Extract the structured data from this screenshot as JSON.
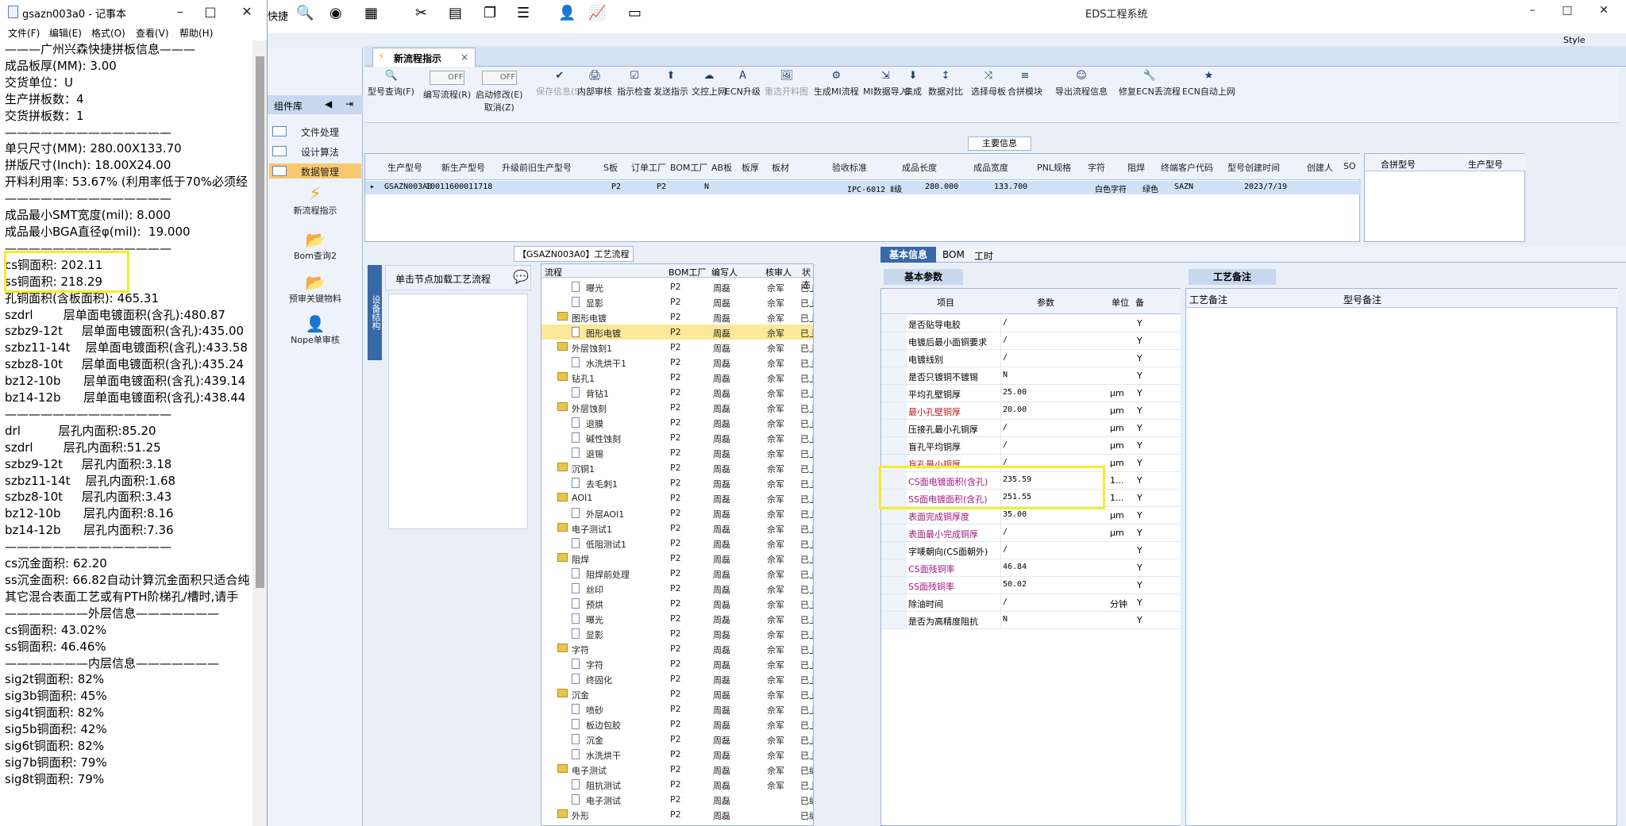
{
  "notepad": {
    "title": "gsazn003a0 - 记事本",
    "menu": [
      "文件(F)",
      "编辑(E)",
      "格式(O)",
      "查看(V)",
      "帮助(H)"
    ],
    "lines": [
      "———广州兴森快捷拼板信息———",
      "成品板厚(MM): 3.00",
      "交货单位：U",
      "生产拼板数：4",
      "交货拼板数：1",
      "——————————————",
      "单只尺寸(MM): 280.00X133.70",
      "拼版尺寸(Inch): 18.00X24.00",
      "开料利用率: 53.67% (利用率低于70%必须经",
      "——————————————",
      "成品最小SMT宽度(mil): 8.000",
      "成品最小BGA直径φ(mil):  19.000",
      "——————————————",
      "cs铜面积: 202.11",
      "ss铜面积: 218.29",
      "孔铜面积(含板面积): 465.31",
      "szdrl        层单面电镀面积(含孔):480.87",
      "szbz9-12t     层单面电镀面积(含孔):435.00",
      "szbz11-14t    层单面电镀面积(含孔):433.58",
      "szbz8-10t     层单面电镀面积(含孔):435.24",
      "bz12-10b      层单面电镀面积(含孔):439.14",
      "bz14-12b      层单面电镀面积(含孔):438.44",
      "",
      "——————————————",
      "drl          层孔内面积:85.20",
      "szdrl        层孔内面积:51.25",
      "szbz9-12t     层孔内面积:3.18",
      "szbz11-14t    层孔内面积:1.68",
      "szbz8-10t     层孔内面积:3.43",
      "bz12-10b      层孔内面积:8.16",
      "bz14-12b      层孔内面积:7.36",
      "",
      "——————————————",
      "cs沉金面积: 62.20",
      "ss沉金面积: 66.82自动计算沉金面积只适合纯",
      "其它混合表面工艺或有PTH阶梯孔/槽时,请手",
      "———————外层信息———————",
      "cs铜面积: 43.02%",
      "ss铜面积: 46.46%",
      "———————内层信息———————",
      "sig2t铜面积: 82%",
      "sig3b铜面积: 45%",
      "sig4t铜面积: 82%",
      "sig5b铜面积: 42%",
      "sig6t铜面积: 82%",
      "sig7b铜面积: 79%",
      "sig8t铜面积: 79%"
    ]
  },
  "eds": {
    "title": "EDS工程系统",
    "quick": "快捷",
    "style": "Style",
    "panel_title": "组件库",
    "nav": [
      "文件处理",
      "设计算法",
      "数据管理"
    ],
    "tools": [
      "新流程指示",
      "Bom查询2",
      "预审关键物料",
      "Nope单审核"
    ],
    "tab": "新流程指示",
    "toolbar": [
      "型号查询(F)",
      "编写流程(R)",
      "启动修改(E)",
      "保存信息(S)",
      "内部审核",
      "指示检查",
      "发送指示",
      "文控上网",
      "ECN升级",
      "重选开料图",
      "生成MI流程",
      "MI数据导入",
      "集成",
      "数据对比",
      "选择母板",
      "合拼模块",
      "导出流程信息",
      "修复ECN丢流程",
      "ECN自动上网"
    ],
    "toolbar_sub": "取消(Z)",
    "off": "OFF",
    "main_info": "主要信息",
    "main_cols": [
      "生产型号",
      "新生产型号",
      "升级前旧生产型号",
      "S板",
      "订单工厂",
      "BOM工厂",
      "AB板",
      "板厚",
      "板材",
      "验收标准",
      "成品长度",
      "成品宽度",
      "PNL规格",
      "字符",
      "阻焊",
      "终端客户代码",
      "型号创建时间",
      "创建人",
      "SO"
    ],
    "main_row": {
      "model": "GSAZN003A0",
      "new_model": "10011600011718",
      "order_factory": "P2",
      "bom_factory": "P2",
      "ab": "N",
      "standard": "IPC-6012 Ⅱ级",
      "length": "280.000",
      "width": "133.700",
      "char": "白色字符",
      "solder": "绿色",
      "customer": "SAZN",
      "created": "2023/7/19"
    },
    "right_cols": [
      "合拼型号",
      "生产型号"
    ],
    "process_title": "【GSAZN003A0】工艺流程",
    "side_tab": "设备结构",
    "click_tip": "单击节点加载工艺流程",
    "tree_cols": [
      "流程",
      "BOM工厂",
      "编写人",
      "核审人",
      "状态"
    ],
    "tree": [
      {
        "l": 2,
        "n": "曝光",
        "f": 0,
        "s": "已上R"
      },
      {
        "l": 2,
        "n": "显影",
        "f": 0,
        "s": "已上R"
      },
      {
        "l": 1,
        "n": "图形电镀",
        "f": 1,
        "s": "已上R"
      },
      {
        "l": 2,
        "n": "图形电镀",
        "f": 0,
        "s": "已上R",
        "sel": true
      },
      {
        "l": 1,
        "n": "外层蚀刻1",
        "f": 1,
        "s": "已上R"
      },
      {
        "l": 2,
        "n": "水洗烘干1",
        "f": 0,
        "s": "已上R"
      },
      {
        "l": 1,
        "n": "钻孔1",
        "f": 1,
        "s": "已上R"
      },
      {
        "l": 2,
        "n": "背钻1",
        "f": 0,
        "s": "已上R"
      },
      {
        "l": 1,
        "n": "外层蚀刻",
        "f": 1,
        "s": "已上R"
      },
      {
        "l": 2,
        "n": "退膜",
        "f": 0,
        "s": "已上R"
      },
      {
        "l": 2,
        "n": "碱性蚀刻",
        "f": 0,
        "s": "已上R"
      },
      {
        "l": 2,
        "n": "退锡",
        "f": 0,
        "s": "已上R"
      },
      {
        "l": 1,
        "n": "沉铜1",
        "f": 1,
        "s": "已上R"
      },
      {
        "l": 2,
        "n": "去毛刺1",
        "f": 0,
        "s": "已上R"
      },
      {
        "l": 1,
        "n": "AOI1",
        "f": 1,
        "s": "已上R"
      },
      {
        "l": 2,
        "n": "外层AOI1",
        "f": 0,
        "s": "已上R"
      },
      {
        "l": 1,
        "n": "电子测试1",
        "f": 1,
        "s": "已上R"
      },
      {
        "l": 2,
        "n": "低阻测试1",
        "f": 0,
        "s": "已上R"
      },
      {
        "l": 1,
        "n": "阻焊",
        "f": 1,
        "s": "已上R"
      },
      {
        "l": 2,
        "n": "阻焊前处理",
        "f": 0,
        "s": "已上R"
      },
      {
        "l": 2,
        "n": "丝印",
        "f": 0,
        "s": "已上R"
      },
      {
        "l": 2,
        "n": "预烘",
        "f": 0,
        "s": "已上R"
      },
      {
        "l": 2,
        "n": "曝光",
        "f": 0,
        "s": "已上R"
      },
      {
        "l": 2,
        "n": "显影",
        "f": 0,
        "s": "已上R"
      },
      {
        "l": 1,
        "n": "字符",
        "f": 1,
        "s": "已上R"
      },
      {
        "l": 2,
        "n": "字符",
        "f": 0,
        "s": "已上R"
      },
      {
        "l": 2,
        "n": "终固化",
        "f": 0,
        "s": "已上R"
      },
      {
        "l": 1,
        "n": "沉金",
        "f": 1,
        "s": "已上R"
      },
      {
        "l": 2,
        "n": "喷砂",
        "f": 0,
        "s": "已上R"
      },
      {
        "l": 2,
        "n": "板边包胶",
        "f": 0,
        "s": "已上R"
      },
      {
        "l": 2,
        "n": "沉金",
        "f": 0,
        "s": "已上R"
      },
      {
        "l": 2,
        "n": "水洗烘干",
        "f": 0,
        "s": "已上R"
      },
      {
        "l": 1,
        "n": "电子测试",
        "f": 1,
        "s": "已编S"
      },
      {
        "l": 2,
        "n": "阻抗测试",
        "f": 0,
        "s": "已上R"
      },
      {
        "l": 2,
        "n": "电子测试",
        "f": 0,
        "s": "已编S",
        "noaudit": true
      },
      {
        "l": 1,
        "n": "外形",
        "f": 1,
        "s": "已编S",
        "noaudit": true
      }
    ],
    "tree_factory": "P2",
    "tree_writer": "周磊",
    "tree_auditor": "佘军",
    "bi_tabs": [
      "基本信息",
      "BOM",
      "工时"
    ],
    "bp_title": "基本参数",
    "bp_cols": [
      "项目",
      "参数",
      "单位",
      "备"
    ],
    "bp_rows": [
      {
        "k": "是否贴导电胶",
        "v": "/",
        "u": "",
        "y": "Y",
        "c": ""
      },
      {
        "k": "电镀后最小面铜要求",
        "v": "/",
        "u": "",
        "y": "Y",
        "c": ""
      },
      {
        "k": "电镀线别",
        "v": "/",
        "u": "",
        "y": "Y",
        "c": ""
      },
      {
        "k": "是否只镀铜不镀锡",
        "v": "N",
        "u": "",
        "y": "Y",
        "c": ""
      },
      {
        "k": "平均孔壁铜厚",
        "v": "25.00",
        "u": "μm",
        "y": "Y",
        "c": ""
      },
      {
        "k": "最小孔壁铜厚",
        "v": "20.00",
        "u": "μm",
        "y": "Y",
        "c": "red"
      },
      {
        "k": "压接孔最小孔铜厚",
        "v": "/",
        "u": "μm",
        "y": "Y",
        "c": ""
      },
      {
        "k": "盲孔平均铜厚",
        "v": "/",
        "u": "μm",
        "y": "Y",
        "c": ""
      },
      {
        "k": "盲孔最小铜厚",
        "v": "/",
        "u": "μm",
        "y": "Y",
        "c": "red"
      },
      {
        "k": "CS面电镀面积(含孔)",
        "v": "235.59",
        "u": "1...",
        "y": "Y",
        "c": "pur"
      },
      {
        "k": "SS面电镀面积(含孔)",
        "v": "251.55",
        "u": "1...",
        "y": "Y",
        "c": "pur"
      },
      {
        "k": "表面完成铜厚度",
        "v": "35.00",
        "u": "μm",
        "y": "Y",
        "c": "pur"
      },
      {
        "k": "表面最小完成铜厚",
        "v": "/",
        "u": "μm",
        "y": "Y",
        "c": "pur"
      },
      {
        "k": "字唛朝向(CS面朝外)",
        "v": "/",
        "u": "",
        "y": "Y",
        "c": ""
      },
      {
        "k": "CS面残铜率",
        "v": "46.84",
        "u": "",
        "y": "Y",
        "c": "pur"
      },
      {
        "k": "SS面残铜率",
        "v": "50.02",
        "u": "",
        "y": "Y",
        "c": "pur"
      },
      {
        "k": "除油时间",
        "v": "/",
        "u": "分钟",
        "y": "Y",
        "c": ""
      },
      {
        "k": "是否为高精度阻抗",
        "v": "N",
        "u": "",
        "y": "Y",
        "c": ""
      }
    ],
    "pr_title": "工艺备注",
    "pr_cols": [
      "工艺备注",
      "型号备注"
    ]
  }
}
